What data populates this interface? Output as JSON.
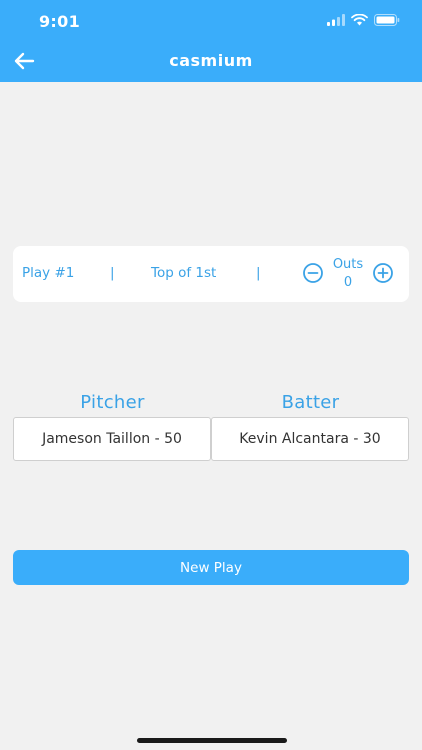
{
  "status_bar": {
    "time": "9:01",
    "icons": [
      "cellular-signal-icon",
      "wifi-icon",
      "battery-icon"
    ]
  },
  "header": {
    "title": "casmium",
    "back_icon": "arrow-left-icon"
  },
  "play_bar": {
    "play_number": "Play #1",
    "separator": "|",
    "inning": "Top of 1st",
    "outs_label": "Outs",
    "outs_value": "0",
    "minus_icon": "minus-circle-icon",
    "plus_icon": "plus-circle-icon"
  },
  "matchup": {
    "pitcher_label": "Pitcher",
    "batter_label": "Batter",
    "pitcher_value": "Jameson Taillon - 50",
    "batter_value": "Kevin Alcantara - 30"
  },
  "actions": {
    "new_play_label": "New Play"
  },
  "colors": {
    "primary": "#3aadfa",
    "accent_text": "#3aa2e6",
    "background": "#f1f1f1"
  }
}
